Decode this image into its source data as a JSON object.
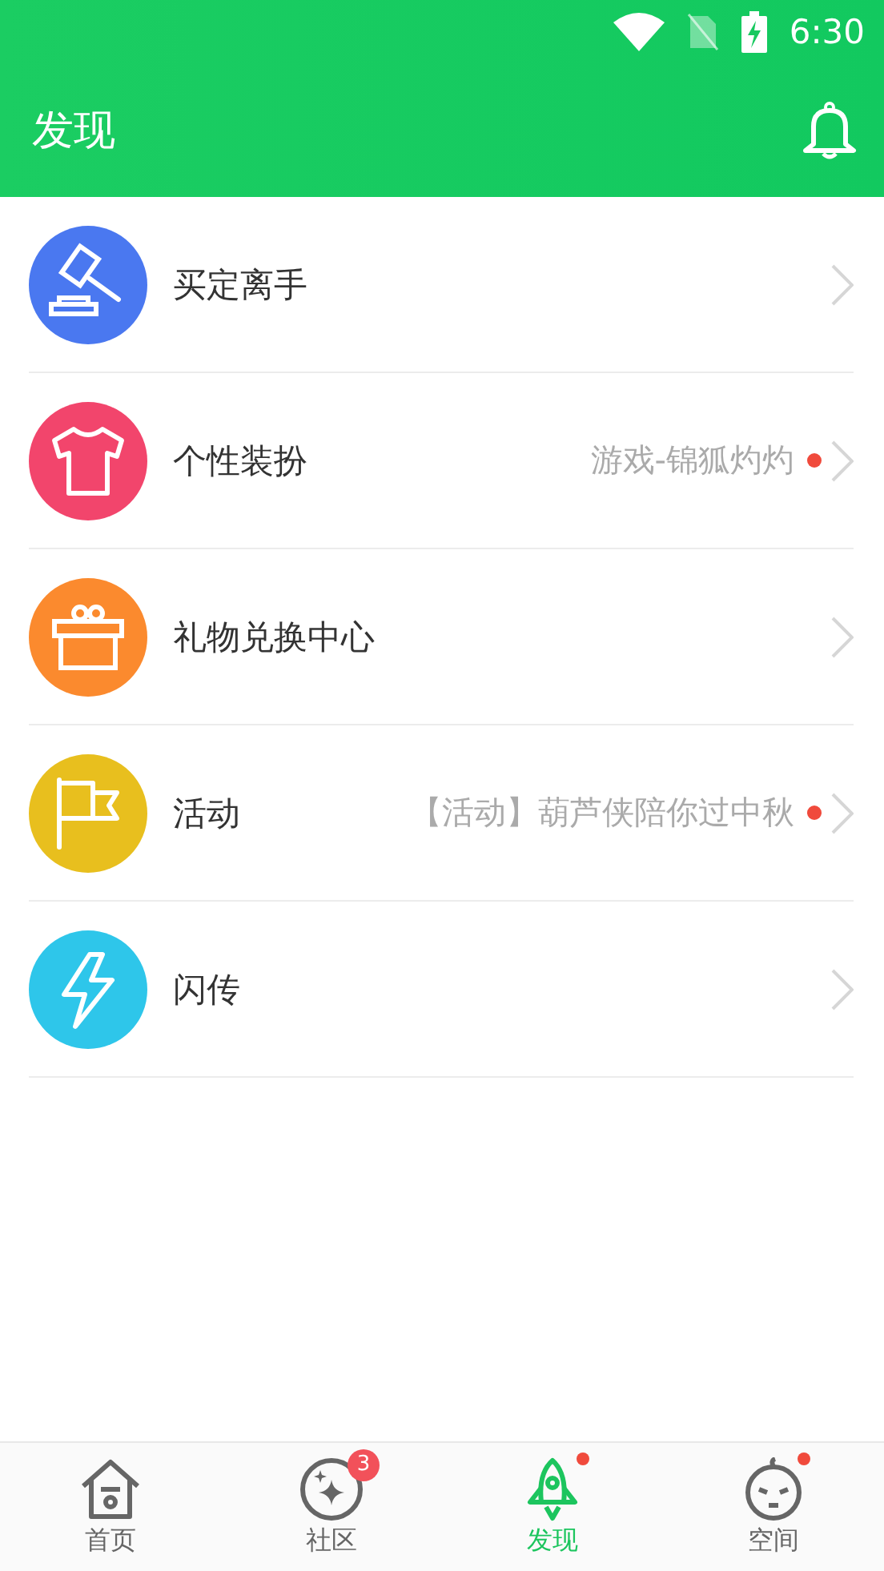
{
  "status_bar": {
    "time": "6:30"
  },
  "header": {
    "title": "发现"
  },
  "items": [
    {
      "kind": "gavel",
      "color": "#4a78f0",
      "title": "买定离手",
      "dot": false
    },
    {
      "kind": "shirt",
      "color": "#f2456c",
      "title": "个性装扮",
      "subtitle": "游戏-锦狐灼灼",
      "dot": true
    },
    {
      "kind": "gift",
      "color": "#fb8a2e",
      "title": "礼物兑换中心",
      "dot": false
    },
    {
      "kind": "flag",
      "color": "#e8bf1e",
      "title": "活动",
      "subtitle": "【活动】葫芦侠陪你过中秋",
      "dot": true
    },
    {
      "kind": "bolt",
      "color": "#2ec6ea",
      "title": "闪传",
      "dot": false
    }
  ],
  "tabs": [
    {
      "kind": "home",
      "label": "首页",
      "selected": false,
      "dot": false
    },
    {
      "kind": "community",
      "label": "社区",
      "selected": false,
      "badge": "3",
      "dot": false
    },
    {
      "kind": "discover",
      "label": "发现",
      "selected": true,
      "dot": true
    },
    {
      "kind": "space",
      "label": "空间",
      "selected": false,
      "dot": true
    }
  ]
}
